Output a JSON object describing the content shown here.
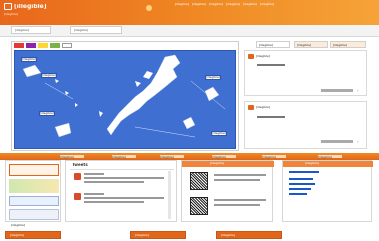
{
  "header": {
    "title": "[illegible]",
    "subtitle": "[illegible]",
    "top_links": [
      "[illegible]",
      "[illegible]",
      "[illegible]",
      "[illegible]",
      "[illegible]",
      "[illegible]"
    ]
  },
  "nav": {
    "tabs": [
      "[illegible]",
      "[illegible]"
    ]
  },
  "map": {
    "region_labels": [
      "[illegible]",
      "[illegible]",
      "[illegible]",
      "[illegible]",
      "[illegible]"
    ],
    "legend_colors": [
      "#e53935",
      "#8e24aa",
      "#fdd835",
      "#7cb342",
      "#ffffff"
    ]
  },
  "sidebar": {
    "tabs": [
      "[illegible]",
      "[illegible]",
      "[illegible]"
    ],
    "warning_box": {
      "title": "[illegible]"
    },
    "alert_box": {
      "title": "[illegible]"
    }
  },
  "lower": {
    "bar_links": [
      "[illegible]",
      "[illegible]",
      "[illegible]",
      "[illegible]",
      "[illegible]",
      "[illegible]"
    ],
    "tweets_title": "Tweets",
    "qr_title": "[illegible]",
    "links_title": "[illegible]"
  },
  "footer": {
    "label": "[illegible]",
    "buttons": [
      "[illegible]",
      "[illegible]",
      "[illegible]"
    ]
  },
  "colors": {
    "accent": "#e0661a",
    "map_sea": "#3f6fd1",
    "land": "#ffffff"
  }
}
